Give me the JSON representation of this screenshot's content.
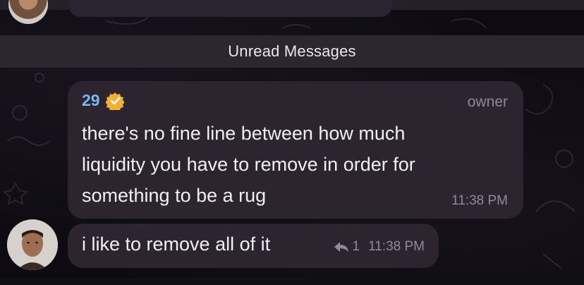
{
  "divider": {
    "label": "Unread Messages"
  },
  "message": {
    "sender": "29",
    "role": "owner",
    "lines": [
      "there's no fine line between how much",
      "liquidity you have to remove in order for",
      "something to be a rug"
    ],
    "time": "11:38 PM"
  },
  "reply": {
    "text": "i like to remove all of it",
    "reply_count": "1",
    "time": "11:38 PM"
  },
  "icons": {
    "verified": "verified-badge-icon",
    "reply": "reply-arrow-icon"
  },
  "colors": {
    "sender_name": "#79b7f2",
    "verified_badge": "#f2b132",
    "bubble": "#2c2530"
  }
}
